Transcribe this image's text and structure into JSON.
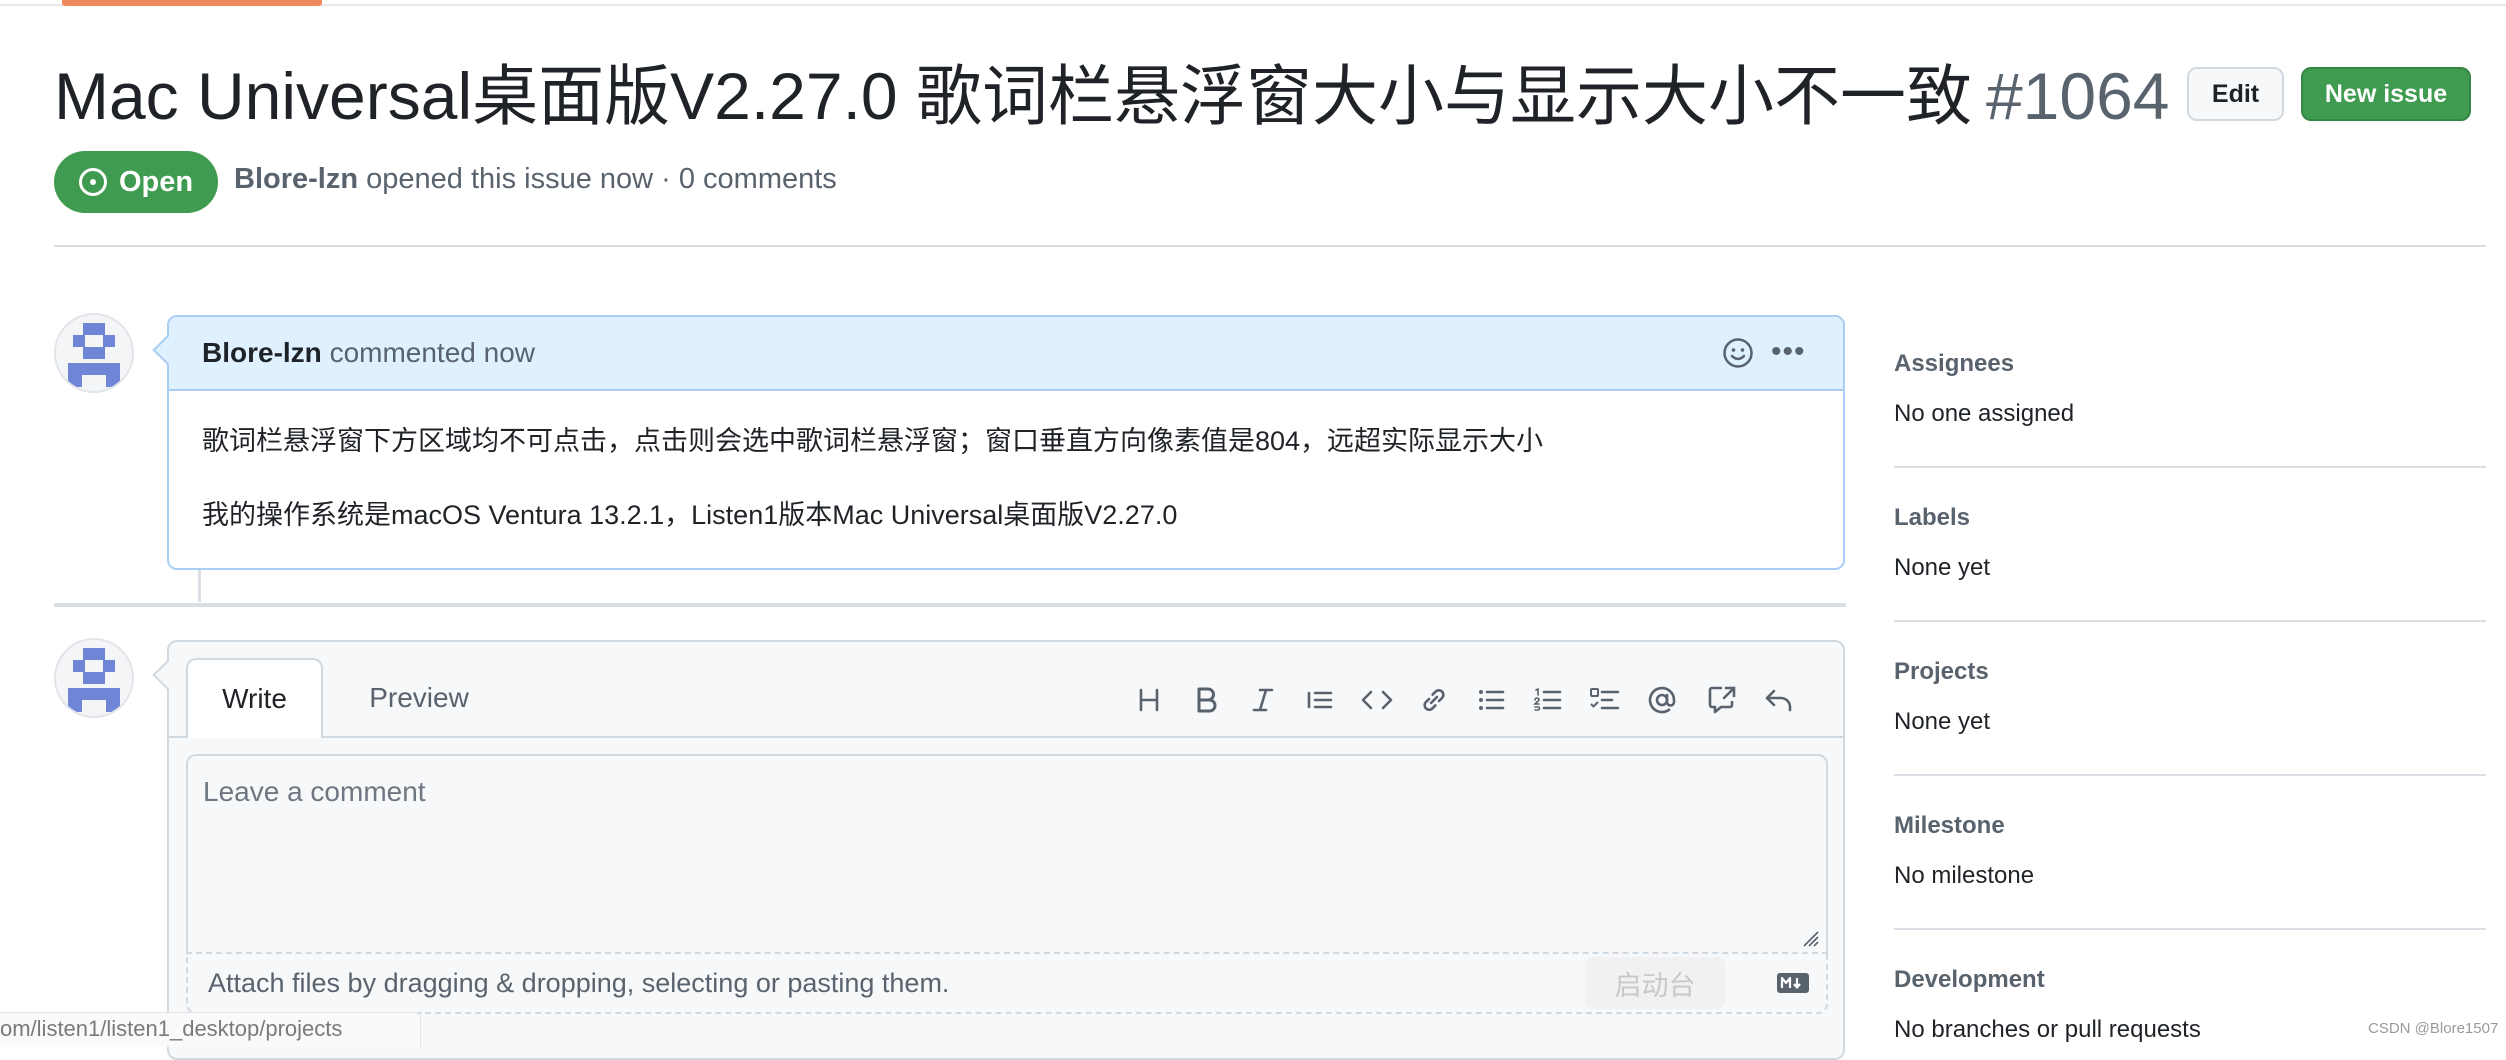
{
  "issue": {
    "title": "Mac Universal桌面版V2.27.0 歌词栏悬浮窗大小与显示大小不一致",
    "number": "#1064",
    "state": "Open",
    "author": "Blore-lzn",
    "meta_rest": "opened this issue now · 0 comments"
  },
  "header_buttons": {
    "edit": "Edit",
    "new_issue": "New issue"
  },
  "comment": {
    "author": "Blore-lzn",
    "action": "commented now",
    "paragraphs": [
      "歌词栏悬浮窗下方区域均不可点击，点击则会选中歌词栏悬浮窗；窗口垂直方向像素值是804，远超实际显示大小",
      "我的操作系统是macOS Ventura 13.2.1，Listen1版本Mac Universal桌面版V2.27.0"
    ]
  },
  "composer": {
    "tabs": [
      "Write",
      "Preview"
    ],
    "placeholder": "Leave a comment",
    "attach_text": "Attach files by dragging & dropping, selecting or pasting them.",
    "toolbar_icons": [
      "heading-icon",
      "bold-icon",
      "italic-icon",
      "quote-icon",
      "code-icon",
      "link-icon",
      "unordered-list-icon",
      "ordered-list-icon",
      "task-list-icon",
      "mention-icon",
      "cross-reference-icon",
      "reply-icon"
    ]
  },
  "sidebar": [
    {
      "heading": "Assignees",
      "value": "No one assigned"
    },
    {
      "heading": "Labels",
      "value": "None yet"
    },
    {
      "heading": "Projects",
      "value": "None yet"
    },
    {
      "heading": "Milestone",
      "value": "No milestone"
    },
    {
      "heading": "Development",
      "value": "No branches or pull requests"
    }
  ],
  "overlay": {
    "launchpad": "启动台",
    "status_url": "om/listen1/listen1_desktop/projects",
    "watermark": "CSDN @Blore1507"
  },
  "colors": {
    "open_green": "#3f9b4f",
    "comment_header": "#dff0ff",
    "comment_border": "#a9cdf5",
    "accent": "#f08a5d"
  }
}
